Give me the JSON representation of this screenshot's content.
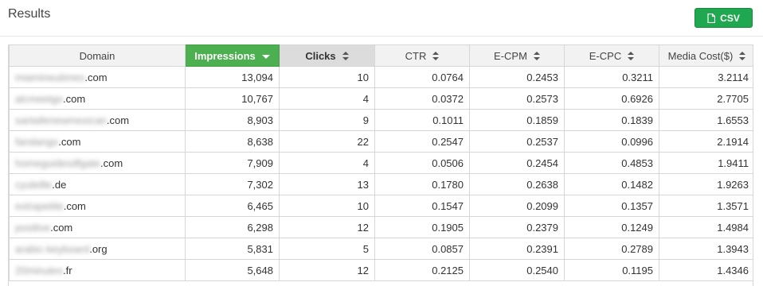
{
  "header": {
    "title": "Results",
    "csv_label": "CSV",
    "csv_icon": "file-icon",
    "csv_color": "#1fa84f"
  },
  "table": {
    "columns": [
      {
        "key": "domain",
        "label": "Domain",
        "sort": "none"
      },
      {
        "key": "impressions",
        "label": "Impressions",
        "sort": "desc"
      },
      {
        "key": "clicks",
        "label": "Clicks",
        "sort": "both"
      },
      {
        "key": "ctr",
        "label": "CTR",
        "sort": "both"
      },
      {
        "key": "ecpm",
        "label": "E-CPM",
        "sort": "both"
      },
      {
        "key": "ecpc",
        "label": "E-CPC",
        "sort": "both"
      },
      {
        "key": "media_cost",
        "label": "Media Cost($)",
        "sort": "both"
      }
    ],
    "rows": [
      {
        "domain_blurred": "miamineutimes",
        "domain_suffix": ".com",
        "impressions": "13,094",
        "clicks": "10",
        "ctr": "0.0764",
        "ecpm": "0.2453",
        "ecpc": "0.3211",
        "media_cost": "3.2114"
      },
      {
        "domain_blurred": "alcmeetgo",
        "domain_suffix": ".com",
        "impressions": "10,767",
        "clicks": "4",
        "ctr": "0.0372",
        "ecpm": "0.2573",
        "ecpc": "0.6926",
        "media_cost": "2.7705"
      },
      {
        "domain_blurred": "santafenewmexican",
        "domain_suffix": ".com",
        "impressions": "8,903",
        "clicks": "9",
        "ctr": "0.1011",
        "ecpm": "0.1859",
        "ecpc": "0.1839",
        "media_cost": "1.6553"
      },
      {
        "domain_blurred": "fandango",
        "domain_suffix": ".com",
        "impressions": "8,638",
        "clicks": "22",
        "ctr": "0.2547",
        "ecpm": "0.2537",
        "ecpc": "0.0996",
        "media_cost": "2.1914"
      },
      {
        "domain_blurred": "homeguidesdfgate",
        "domain_suffix": ".com",
        "impressions": "7,909",
        "clicks": "4",
        "ctr": "0.0506",
        "ecpm": "0.2454",
        "ecpc": "0.4853",
        "media_cost": "1.9411"
      },
      {
        "domain_blurred": "cyuleille",
        "domain_suffix": ".de",
        "impressions": "7,302",
        "clicks": "13",
        "ctr": "0.1780",
        "ecpm": "0.2638",
        "ecpc": "0.1482",
        "media_cost": "1.9263"
      },
      {
        "domain_blurred": "extrapetite",
        "domain_suffix": ".com",
        "impressions": "6,465",
        "clicks": "10",
        "ctr": "0.1547",
        "ecpm": "0.2099",
        "ecpc": "0.1357",
        "media_cost": "1.3571"
      },
      {
        "domain_blurred": "positive",
        "domain_suffix": ".com",
        "impressions": "6,298",
        "clicks": "12",
        "ctr": "0.1905",
        "ecpm": "0.2379",
        "ecpc": "0.1249",
        "media_cost": "1.4984"
      },
      {
        "domain_blurred": "arabic-keyboard",
        "domain_suffix": ".org",
        "impressions": "5,831",
        "clicks": "5",
        "ctr": "0.0857",
        "ecpm": "0.2391",
        "ecpc": "0.2789",
        "media_cost": "1.3943"
      },
      {
        "domain_blurred": "20minutes",
        "domain_suffix": ".fr",
        "impressions": "5,648",
        "clicks": "12",
        "ctr": "0.2125",
        "ecpm": "0.2540",
        "ecpc": "0.1195",
        "media_cost": "1.4346"
      }
    ]
  }
}
